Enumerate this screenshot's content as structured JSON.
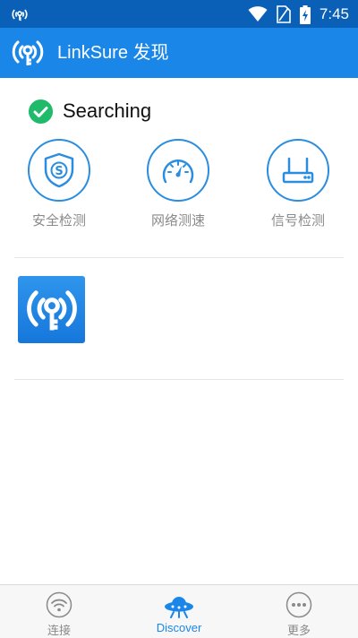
{
  "statusbar": {
    "time": "7:45",
    "icons": [
      "wifi-key-icon",
      "wifi-signal-icon",
      "no-sim-icon",
      "battery-charging-icon"
    ]
  },
  "appbar": {
    "title": "LinkSure 发现"
  },
  "search_status": {
    "label": "Searching"
  },
  "tools": [
    {
      "label": "安全检测",
      "icon": "shield-s-icon"
    },
    {
      "label": "网络测速",
      "icon": "speedometer-icon"
    },
    {
      "label": "信号检测",
      "icon": "router-icon"
    }
  ],
  "apps": [
    {
      "icon": "wifi-key-app-icon"
    }
  ],
  "bottom_nav": [
    {
      "label": "连接",
      "icon": "wifi-icon"
    },
    {
      "label": "Discover",
      "icon": "ufo-icon",
      "active": true
    },
    {
      "label": "更多",
      "icon": "more-icon"
    }
  ],
  "colors": {
    "status_bar": "#0a60b7",
    "app_bar": "#1a87e8",
    "accent": "#2a8de0",
    "check": "#1fba6a"
  }
}
